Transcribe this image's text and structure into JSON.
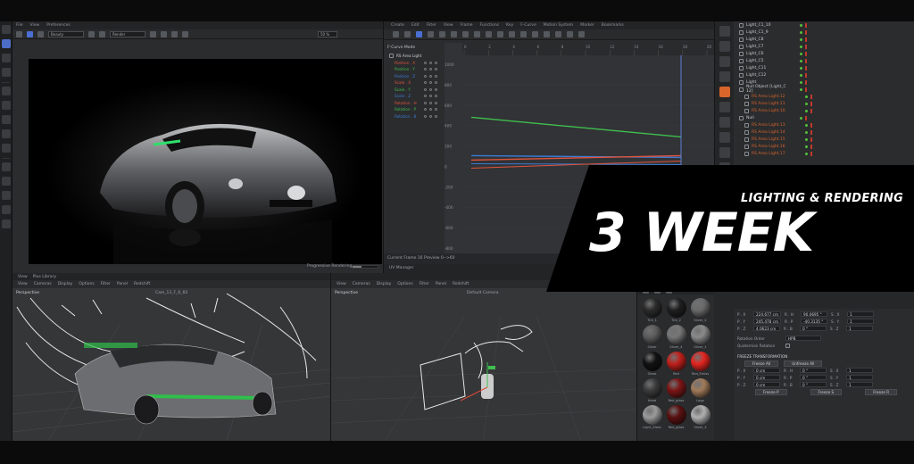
{
  "overlay": {
    "subtitle": "LIGHTING & RENDERING",
    "title": "3 WEEK"
  },
  "render_view": {
    "menu": [
      "File",
      "View",
      "Preferences"
    ],
    "render_preset": "Beauty",
    "render_mode": "Render",
    "zoom": "50 %",
    "progress_label": "Progressive Rendering...",
    "progress": 0.35
  },
  "fcurve": {
    "menu": [
      "Create",
      "Edit",
      "Filter",
      "View",
      "Frame",
      "Functions",
      "Key",
      "F-Curve",
      "Motion System",
      "Marker",
      "Bookmarks"
    ],
    "mode_label": "F-Curve Mode",
    "object": "RS Area Light",
    "tracks": [
      {
        "label": "Position . X",
        "color": "#e0543c"
      },
      {
        "label": "Position . Y",
        "color": "#3fbf4f"
      },
      {
        "label": "Position . Z",
        "color": "#3a7bd5"
      },
      {
        "label": "Scale . X",
        "color": "#e0543c"
      },
      {
        "label": "Scale . Y",
        "color": "#3fbf4f"
      },
      {
        "label": "Scale . Z",
        "color": "#3a7bd5"
      },
      {
        "label": "Rotation . H",
        "color": "#e0543c"
      },
      {
        "label": "Rotation . P",
        "color": "#3fbf4f"
      },
      {
        "label": "Rotation . B",
        "color": "#3a7bd5"
      }
    ],
    "y_ticks": [
      "1000",
      "800",
      "600",
      "400",
      "200",
      "0",
      "-200",
      "-400",
      "-600",
      "-800"
    ],
    "frame_ticks": [
      "0",
      "2",
      "4",
      "6",
      "8",
      "10",
      "12",
      "14",
      "16",
      "18",
      "20"
    ],
    "status": "Current Frame  16  Preview  0-->60",
    "uv_label": "UV Manager"
  },
  "object_manager": {
    "items": [
      {
        "label": "Light_C1_10",
        "depth": 0
      },
      {
        "label": "Light_C1_9",
        "depth": 0
      },
      {
        "label": "Light_C8",
        "depth": 0
      },
      {
        "label": "Light_C7",
        "depth": 0
      },
      {
        "label": "Light_C6",
        "depth": 0
      },
      {
        "label": "Light_C5",
        "depth": 0
      },
      {
        "label": "Light_C11",
        "depth": 0
      },
      {
        "label": "Light_C12",
        "depth": 0
      },
      {
        "label": "Light",
        "depth": 0
      },
      {
        "label": "Null Object [Light_C 12]",
        "depth": 0
      },
      {
        "label": "RS Area Light.12",
        "depth": 1
      },
      {
        "label": "RS Area Light.11",
        "depth": 1
      },
      {
        "label": "RS Area Light.10",
        "depth": 1
      },
      {
        "label": "Null",
        "depth": 0
      },
      {
        "label": "RS Area Light.13",
        "depth": 1
      },
      {
        "label": "RS Area Light.14",
        "depth": 1
      },
      {
        "label": "RS Area Light.15",
        "depth": 1
      },
      {
        "label": "RS Area Light.16",
        "depth": 1
      },
      {
        "label": "RS Area Light.17",
        "depth": 1
      }
    ]
  },
  "viewport_left": {
    "tabs": [
      "View",
      "Plus Library"
    ],
    "menu": [
      "View",
      "Cameras",
      "Display",
      "Options",
      "Filter",
      "Panel",
      "Redshift"
    ],
    "label": "Perspective",
    "camera": "Cam_13_F_6_60"
  },
  "viewport_right": {
    "menu": [
      "View",
      "Cameras",
      "Display",
      "Options",
      "Filter",
      "Panel",
      "Redshift"
    ],
    "label": "Perspective",
    "camera": "Default Camera"
  },
  "materials": [
    {
      "name": "Tire_1",
      "color": "#2a2a2a"
    },
    {
      "name": "Tire_2",
      "color": "#1f1f1f"
    },
    {
      "name": "Silver_2",
      "color": "#6a6a6a"
    },
    {
      "name": "Silver",
      "color": "#5c5c5c"
    },
    {
      "name": "Silver_4",
      "color": "#777777"
    },
    {
      "name": "Silver_1",
      "color": "#8a8a8a"
    },
    {
      "name": "Glass",
      "color": "#111111"
    },
    {
      "name": "Red",
      "color": "#c0201b"
    },
    {
      "name": "Red_Emiss",
      "color": "#e5251f"
    },
    {
      "name": "Head",
      "color": "#3a3a3a"
    },
    {
      "name": "Red_glass",
      "color": "#7b1515"
    },
    {
      "name": "Logo",
      "color": "#a07a5a"
    },
    {
      "name": "Light_Glass",
      "color": "#9a9a9a"
    },
    {
      "name": "Red_glass",
      "color": "#5a1010"
    },
    {
      "name": "Silver_3",
      "color": "#b0b0b0"
    }
  ],
  "attributes": {
    "rows": [
      {
        "a": "P . X",
        "av": "224.677 cm",
        "b": "R . H",
        "bv": "90.0695 °",
        "c": "S . X",
        "cv": "1"
      },
      {
        "a": "P . Y",
        "av": "245.478 cm",
        "b": "R . P",
        "bv": "-40.3135 °",
        "c": "S . Y",
        "cv": "1"
      },
      {
        "a": "P . Z",
        "av": "4.0623 cm",
        "b": "R . B",
        "bv": "0 °",
        "c": "S . Z",
        "cv": "1"
      }
    ],
    "rotation_order_label": "Rotation Order",
    "rotation_order": "HPB",
    "quaternion_label": "Quaternion Rotation",
    "freeze_header": "FREEZE TRANSFORMATION",
    "freeze_all": "Freeze All",
    "unfreeze_all": "Unfreeze All",
    "freeze_rows": [
      {
        "a": "P . X",
        "av": "0 cm",
        "b": "R . H",
        "bv": "0 °",
        "c": "S . X",
        "cv": "1"
      },
      {
        "a": "P . Y",
        "av": "0 cm",
        "b": "R . P",
        "bv": "0 °",
        "c": "S . Y",
        "cv": "1"
      },
      {
        "a": "P . Z",
        "av": "0 cm",
        "b": "R . B",
        "bv": "0 °",
        "c": "S . Z",
        "cv": "1"
      }
    ],
    "freeze_p": "Freeze P",
    "freeze_s": "Freeze S",
    "freeze_r": "Freeze R"
  }
}
